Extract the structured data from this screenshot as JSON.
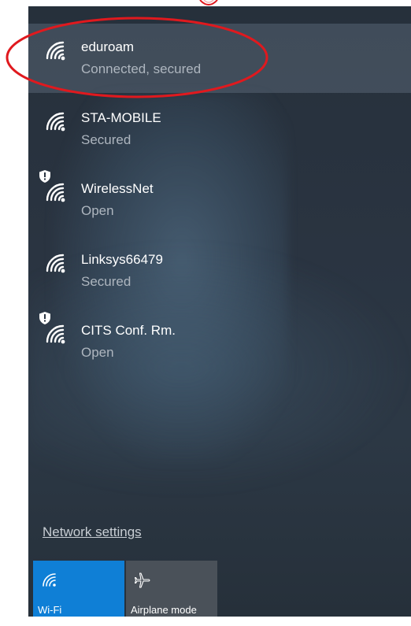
{
  "networks": [
    {
      "name": "eduroam",
      "status": "Connected, secured",
      "icon": "wifi-signal-icon",
      "shield": false,
      "selected": true
    },
    {
      "name": "STA-MOBILE",
      "status": "Secured",
      "icon": "wifi-signal-icon",
      "shield": false,
      "selected": false
    },
    {
      "name": "WirelessNet",
      "status": "Open",
      "icon": "wifi-signal-icon",
      "shield": true,
      "selected": false
    },
    {
      "name": "Linksys66479",
      "status": "Secured",
      "icon": "wifi-signal-icon",
      "shield": false,
      "selected": false
    },
    {
      "name": "CITS Conf. Rm.",
      "status": "Open",
      "icon": "wifi-signal-icon",
      "shield": true,
      "selected": false
    }
  ],
  "network_settings_label": "Network settings",
  "quick_actions": [
    {
      "label": "Wi-Fi",
      "icon": "wifi-icon",
      "active": true
    },
    {
      "label": "Airplane mode",
      "icon": "airplane-icon",
      "active": false
    }
  ],
  "colors": {
    "annotation": "#e0191e",
    "accent": "#0f7fd6",
    "panel": "#2a3441",
    "inactive_tile": "#4a5159"
  }
}
